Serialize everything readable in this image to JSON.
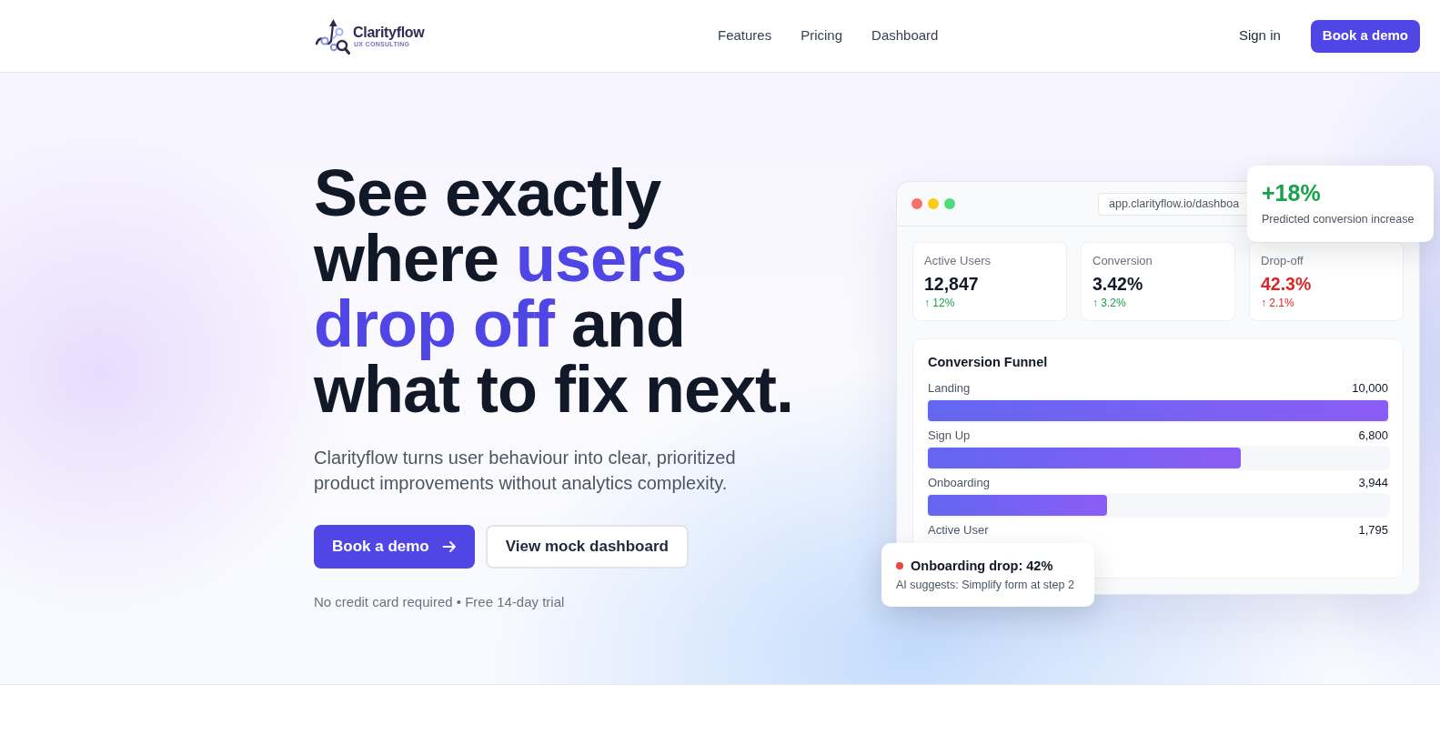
{
  "nav": {
    "brand": {
      "name": "Clarityflow",
      "tagline": "UX CONSULTING"
    },
    "links": [
      "Features",
      "Pricing",
      "Dashboard"
    ],
    "sign_in": "Sign in",
    "cta": "Book a demo"
  },
  "hero": {
    "headline": [
      {
        "text": "See exactly where ",
        "accent": false
      },
      {
        "text": "users drop off",
        "accent": true
      },
      {
        "text": " and what to fix next.",
        "accent": false
      }
    ],
    "subtitle": "Clarityflow turns user behaviour into clear, prioritized product improvements without analytics complexity.",
    "buttons": [
      {
        "label": "Book a demo",
        "kind": "primary"
      },
      {
        "label": "View mock dashboard",
        "kind": "outline"
      }
    ],
    "note": "No credit card required • Free 14-day trial"
  },
  "dashboard": {
    "window_dots": [
      {
        "color": "#f87171"
      },
      {
        "color": "#facc15"
      },
      {
        "color": "#4ade80"
      }
    ],
    "url": "app.clarityflow.io/dashboa",
    "stats": [
      {
        "label": "Active Users",
        "value": "12,847",
        "delta": "↑ 12%",
        "negative": false
      },
      {
        "label": "Conversion",
        "value": "3.42%",
        "delta": "↑ 3.2%",
        "negative": false
      },
      {
        "label": "Drop-off",
        "value": "42.3%",
        "delta": "↑ 2.1%",
        "negative": true
      }
    ],
    "funnel": {
      "title": "Conversion Funnel",
      "steps": [
        {
          "label": "Landing",
          "value": "10,000",
          "level": 1
        },
        {
          "label": "Sign Up",
          "value": "6,800",
          "level": 0.68
        },
        {
          "label": "Onboarding",
          "value": "3,944",
          "level": 0.39
        },
        {
          "label": "Active User",
          "value": "1,795"
        }
      ]
    },
    "prediction": {
      "value": "+18%",
      "caption": "Predicted conversion increase"
    },
    "alert": {
      "title": "Onboarding drop: 42%",
      "text": "AI suggests: Simplify form at step 2"
    }
  }
}
